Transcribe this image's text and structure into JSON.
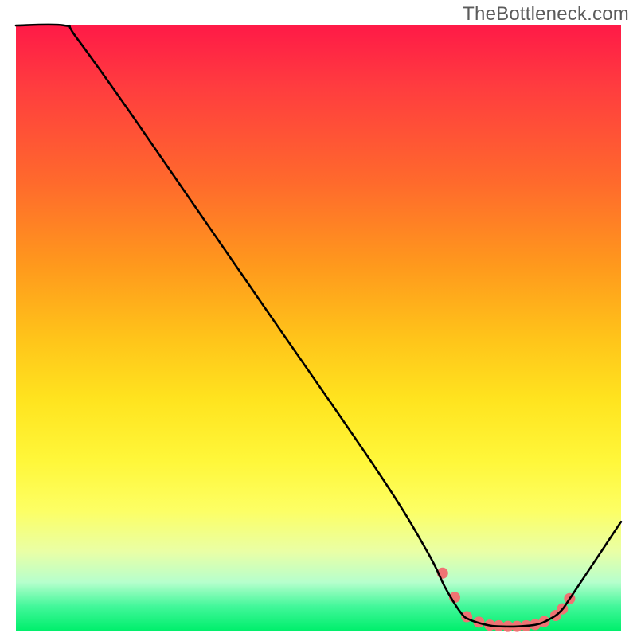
{
  "watermark": "TheBottleneck.com",
  "chart_data": {
    "type": "line",
    "title": "",
    "xlabel": "",
    "ylabel": "",
    "xlim": [
      0,
      100
    ],
    "ylim": [
      0,
      100
    ],
    "note": "Axes are not labeled in the source image; values are expressed as percentages of the visible plot area (0 = left/bottom, 100 = right/top). Color gradient encodes a heat scale from red (high) to green (low).",
    "curve": {
      "name": "bottleneck-curve",
      "color": "#000000",
      "points_xy": [
        [
          0,
          100
        ],
        [
          8,
          100
        ],
        [
          10,
          98
        ],
        [
          20,
          84
        ],
        [
          40,
          55
        ],
        [
          60,
          26
        ],
        [
          68,
          13
        ],
        [
          71,
          7
        ],
        [
          73.5,
          3.0
        ],
        [
          75,
          1.8
        ],
        [
          78,
          0.9
        ],
        [
          80,
          0.7
        ],
        [
          83,
          0.7
        ],
        [
          86,
          1.0
        ],
        [
          88,
          1.8
        ],
        [
          90,
          3.2
        ],
        [
          92,
          6.0
        ],
        [
          100,
          18
        ]
      ]
    },
    "markers": {
      "name": "highlight-dots",
      "color": "#ef7373",
      "radius_px": 7,
      "points_xy": [
        [
          70.5,
          9.5
        ],
        [
          72.5,
          5.5
        ],
        [
          74.5,
          2.3
        ],
        [
          76.5,
          1.4
        ],
        [
          78.3,
          0.9
        ],
        [
          79.8,
          0.8
        ],
        [
          81.3,
          0.7
        ],
        [
          82.8,
          0.7
        ],
        [
          84.3,
          0.8
        ],
        [
          85.8,
          1.0
        ],
        [
          87.3,
          1.5
        ],
        [
          89.2,
          2.5
        ],
        [
          90.3,
          3.6
        ],
        [
          91.5,
          5.3
        ]
      ]
    }
  }
}
